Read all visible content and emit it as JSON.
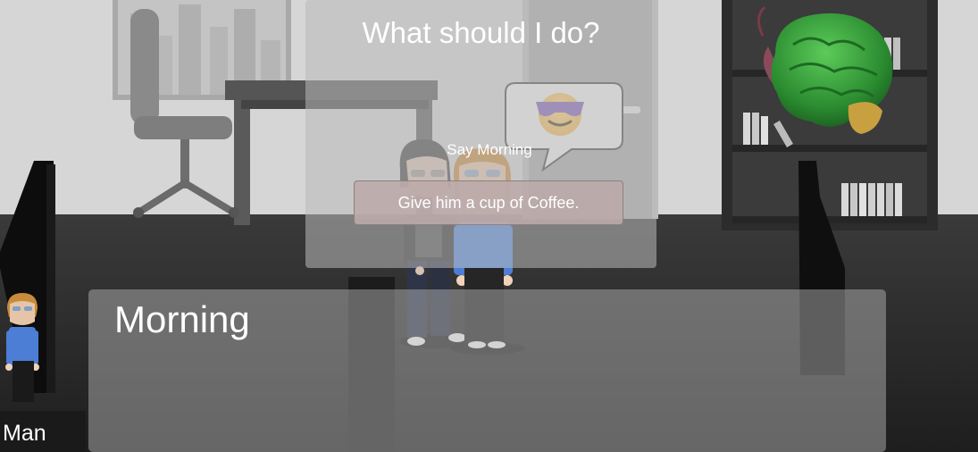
{
  "dialog_choice": {
    "prompt": "What should I do?",
    "option_say": "Say Morning",
    "option_give": "Give him a cup of Coffee.",
    "bubble_icon": "cool-sunglasses-emoji-icon"
  },
  "dialog": {
    "text": "Morning",
    "speaker": "Man"
  },
  "hud": {
    "menu_icon": "brain-icon"
  },
  "colors": {
    "floor": "#262626",
    "wall": "#d8d8d8",
    "panel": "#b9b9b9",
    "button": "#bcaaaa",
    "brain": "#2f8a2f",
    "shirt": "#3d6fd1"
  }
}
